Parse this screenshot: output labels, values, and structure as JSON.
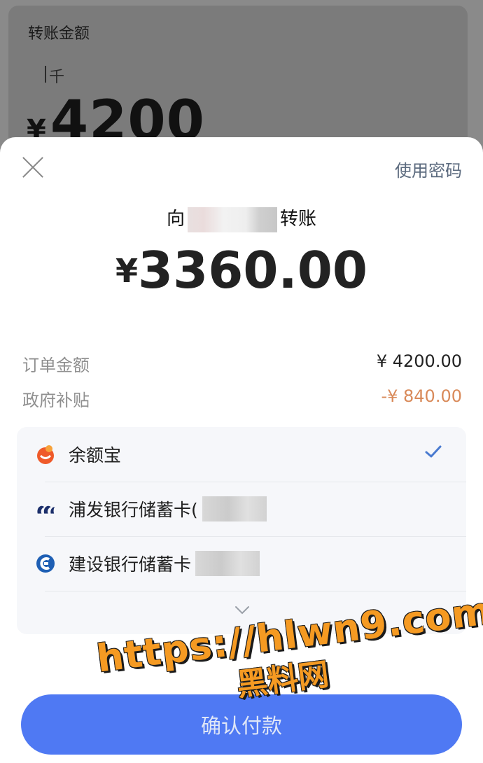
{
  "background": {
    "title": "转账金额",
    "unit_hint": "千",
    "currency": "¥",
    "amount": "4200"
  },
  "sheet": {
    "use_password": "使用密码",
    "recipient_prefix": "向",
    "recipient_suffix": "转账",
    "currency": "¥",
    "amount": "3360.00",
    "order": {
      "label": "订单金额",
      "value": "¥ 4200.00"
    },
    "subsidy": {
      "label": "政府补贴",
      "value": "-¥ 840.00"
    },
    "methods": [
      {
        "name": "余额宝",
        "icon": "yuebao-icon",
        "selected": true
      },
      {
        "name": "浦发银行储蓄卡(",
        "icon": "spdb-icon",
        "selected": false
      },
      {
        "name": "建设银行储蓄卡",
        "icon": "ccb-icon",
        "selected": false
      }
    ],
    "confirm_label": "确认付款"
  },
  "watermark": {
    "line1": "https://hlwn9.com",
    "line2": "黑料网"
  },
  "colors": {
    "accent": "#4f79f3",
    "check": "#4a7bd0",
    "subsidy": "#d98a5a"
  }
}
